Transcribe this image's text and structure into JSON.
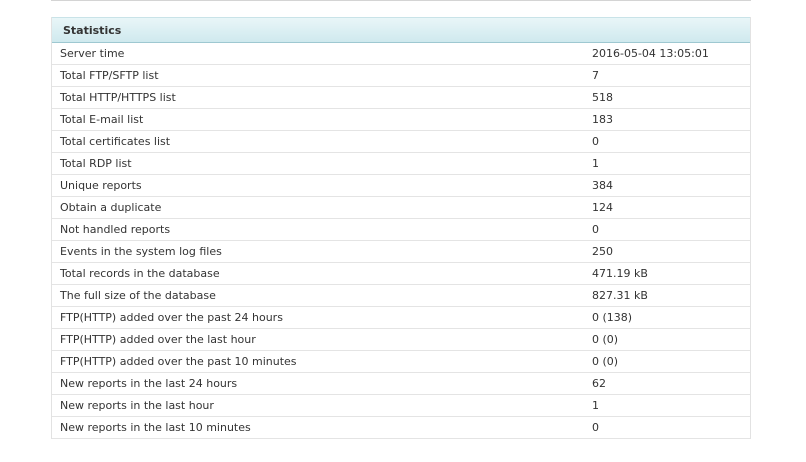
{
  "panel": {
    "title": "Statistics"
  },
  "rows": [
    {
      "label": "Server time",
      "value": "2016-05-04 13:05:01"
    },
    {
      "label": "Total FTP/SFTP list",
      "value": "7"
    },
    {
      "label": "Total HTTP/HTTPS list",
      "value": "518"
    },
    {
      "label": "Total E-mail list",
      "value": "183"
    },
    {
      "label": "Total certificates list",
      "value": "0"
    },
    {
      "label": "Total RDP list",
      "value": "1"
    },
    {
      "label": "Unique reports",
      "value": "384"
    },
    {
      "label": "Obtain a duplicate",
      "value": "124"
    },
    {
      "label": "Not handled reports",
      "value": "0"
    },
    {
      "label": "Events in the system log files",
      "value": "250"
    },
    {
      "label": "Total records in the database",
      "value": "471.19 kB"
    },
    {
      "label": "The full size of the database",
      "value": "827.31 kB"
    },
    {
      "label": "FTP(HTTP) added over the past 24 hours",
      "value": "0 (138)"
    },
    {
      "label": "FTP(HTTP) added over the last hour",
      "value": "0 (0)"
    },
    {
      "label": "FTP(HTTP) added over the past 10 minutes",
      "value": "0 (0)"
    },
    {
      "label": "New reports in the last 24 hours",
      "value": "62"
    },
    {
      "label": "New reports in the last hour",
      "value": "1"
    },
    {
      "label": "New reports in the last 10 minutes",
      "value": "0"
    }
  ]
}
